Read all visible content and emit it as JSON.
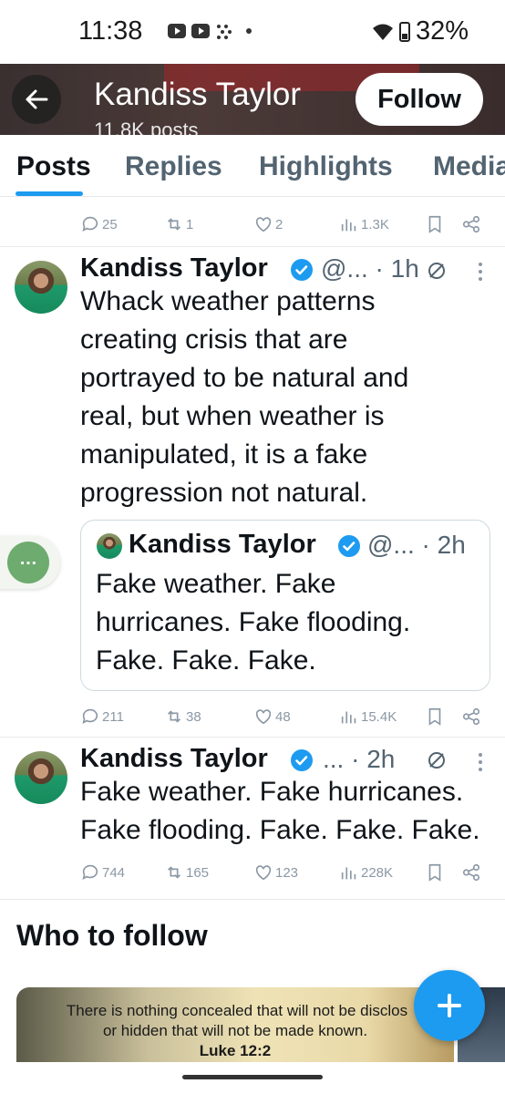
{
  "status_bar": {
    "time": "11:38",
    "battery": "32%"
  },
  "header": {
    "title": "Kandiss Taylor",
    "subtitle": "11.8K posts",
    "follow_label": "Follow"
  },
  "tabs": [
    "Posts",
    "Replies",
    "Highlights",
    "Media"
  ],
  "top_tweet_actions": {
    "replies": "25",
    "reposts": "1",
    "likes": "2",
    "views": "1.3K"
  },
  "tweet1": {
    "name": "Kandiss Taylor",
    "handle": "@... · 1h",
    "body": "Whack weather patterns creating crisis that are portrayed to be natural and real, but when weather is manipulated, it is a fake progression not natural.",
    "quote": {
      "name": "Kandiss Taylor",
      "handle": "@...  · 2h",
      "body": "Fake weather. Fake hurricanes. Fake flooding. Fake. Fake. Fake."
    },
    "actions": {
      "replies": "211",
      "reposts": "38",
      "likes": "48",
      "views": "15.4K"
    }
  },
  "tweet2": {
    "name": "Kandiss Taylor",
    "handle": "...   · 2h",
    "body": "Fake weather. Fake hurricanes. Fake flooding. Fake. Fake. Fake.",
    "actions": {
      "replies": "744",
      "reposts": "165",
      "likes": "123",
      "views": "228K"
    }
  },
  "who_to_follow": {
    "title": "Who to follow",
    "card_line1": "There is nothing concealed that will not be disclos",
    "card_line2": "or hidden that will not be made known.",
    "card_line3": "Luke 12:2"
  },
  "icons": [
    "back-arrow-icon",
    "reply-icon",
    "repost-icon",
    "like-icon",
    "views-icon",
    "bookmark-icon",
    "share-icon",
    "verified-icon",
    "more-icon",
    "compose-icon"
  ],
  "colors": {
    "accent": "#1d9bf0",
    "muted": "#536471"
  }
}
